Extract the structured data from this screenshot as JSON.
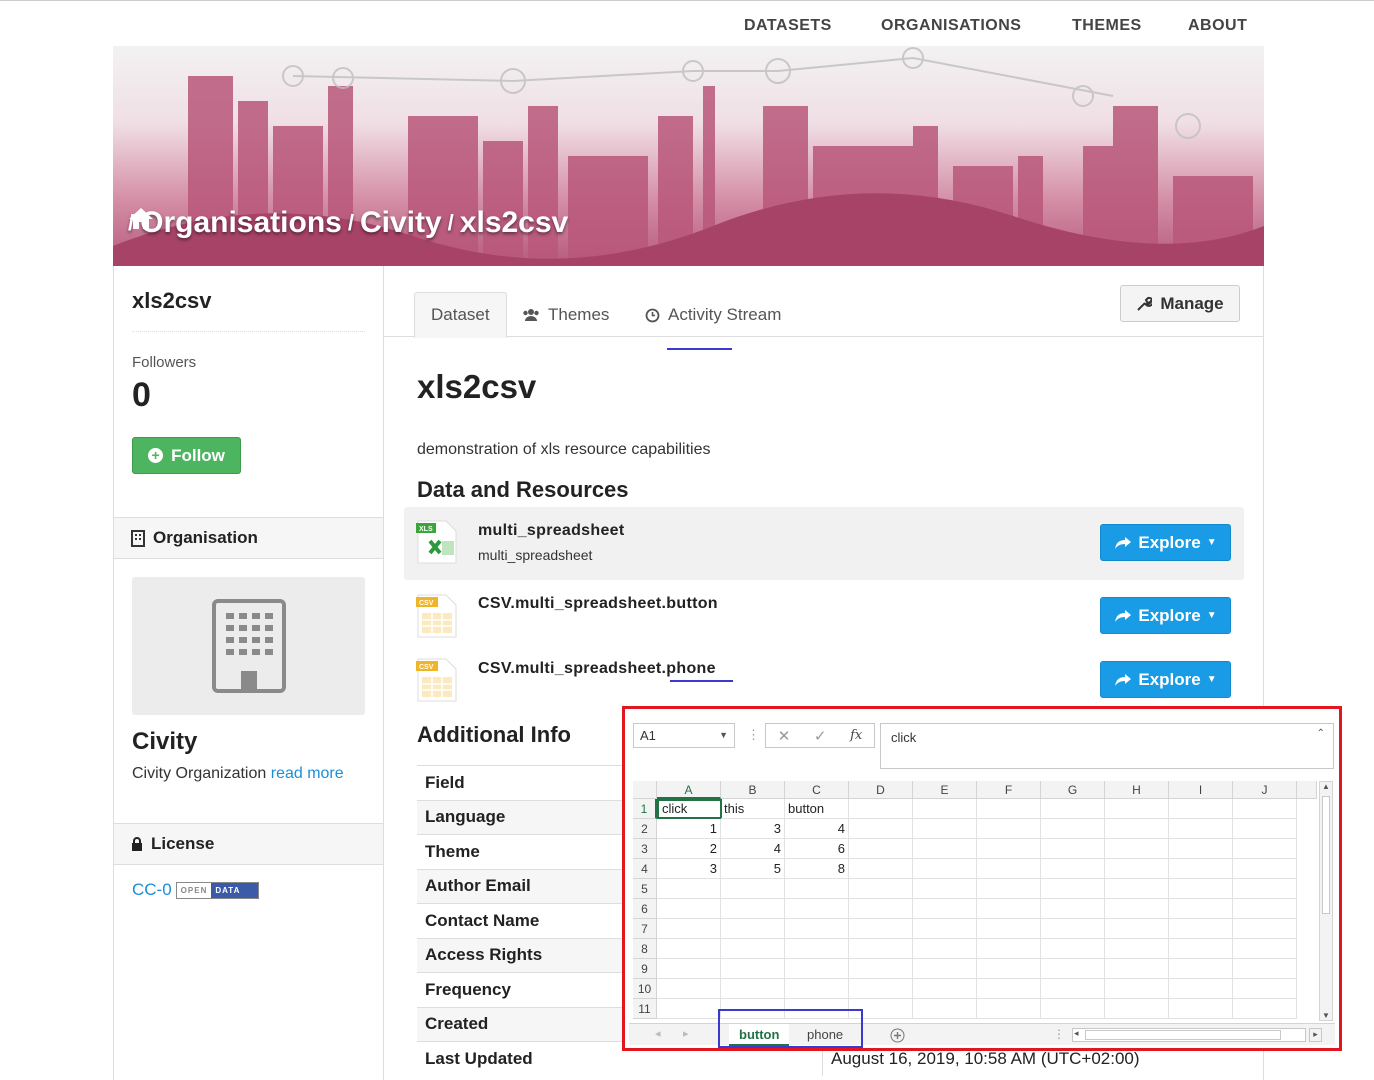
{
  "nav": {
    "items": [
      "DATASETS",
      "ORGANISATIONS",
      "THEMES",
      "ABOUT"
    ]
  },
  "breadcrumb": {
    "sep": "/",
    "items": [
      "Organisations",
      "Civity",
      "xls2csv"
    ]
  },
  "sidebar": {
    "title": "xls2csv",
    "followers_label": "Followers",
    "followers_count": "0",
    "follow_label": "Follow",
    "org_heading": "Organisation",
    "org_name": "Civity",
    "org_desc": "Civity Organization",
    "read_more": "read more",
    "license_heading": "License",
    "license_name": "CC-0",
    "badge_left": "OPEN",
    "badge_right": "DATA"
  },
  "tabs": {
    "dataset": "Dataset",
    "themes": "Themes",
    "activity": "Activity Stream",
    "manage": "Manage"
  },
  "dataset": {
    "title": "xls2csv",
    "description": "demonstration of xls resource capabilities",
    "resources_heading": "Data and Resources",
    "resources": [
      {
        "name": "multi_spreadsheet",
        "sub": "multi_spreadsheet",
        "format": "XLS",
        "explore": "Explore"
      },
      {
        "name": "CSV.multi_spreadsheet.button",
        "format": "CSV",
        "explore": "Explore"
      },
      {
        "name": "CSV.multi_spreadsheet.phone",
        "format": "CSV",
        "explore": "Explore"
      }
    ],
    "additional_heading": "Additional Info",
    "info_rows": [
      {
        "key": "Field",
        "value": ""
      },
      {
        "key": "Language",
        "value": ""
      },
      {
        "key": "Theme",
        "value": ""
      },
      {
        "key": "Author Email",
        "value": ""
      },
      {
        "key": "Contact Name",
        "value": ""
      },
      {
        "key": "Access Rights",
        "value": ""
      },
      {
        "key": "Frequency",
        "value": ""
      },
      {
        "key": "Created",
        "value": ""
      },
      {
        "key": "Last Updated",
        "value": "August 16, 2019, 10:58 AM (UTC+02:00)"
      }
    ]
  },
  "spreadsheet": {
    "name_box": "A1",
    "formula": "click",
    "columns": [
      "A",
      "B",
      "C",
      "D",
      "E",
      "F",
      "G",
      "H",
      "I",
      "J"
    ],
    "rows": [
      "1",
      "2",
      "3",
      "4",
      "5",
      "6",
      "7",
      "8",
      "9",
      "10",
      "11"
    ],
    "cells": [
      [
        "click",
        "this",
        "button"
      ],
      [
        "1",
        "3",
        "4"
      ],
      [
        "2",
        "4",
        "6"
      ],
      [
        "3",
        "5",
        "8"
      ]
    ],
    "sheets": [
      "button",
      "phone"
    ],
    "active_sheet": "button"
  },
  "colors": {
    "accent": "#1a9be6",
    "follow": "#4db55f",
    "excel_green": "#217346",
    "highlight_red": "#e2161f",
    "highlight_blue": "#3a3ad0"
  }
}
